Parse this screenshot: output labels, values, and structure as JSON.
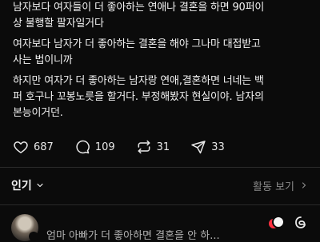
{
  "post": {
    "lines": [
      "남자보다 여자들이 더 좋아하는 연애나 결혼을 하면 90퍼이",
      "상 불행할 팔자일거다",
      "여자보다 남자가 더 좋아하는 결혼을 해야 그나마 대접받고",
      "사는 법이니까",
      "하지만 여자가 더 좋아하는 남자랑 연애,결혼하면 너네는 백",
      "퍼 호구나 꼬봉노릇을 할거다. 부정해봤자 현실이야. 남자의",
      "본능이거던."
    ]
  },
  "actions": {
    "likes": "687",
    "comments": "109",
    "reposts": "31",
    "shares": "33",
    "icons": [
      "heart-icon",
      "comment-icon",
      "repost-icon",
      "share-icon"
    ]
  },
  "sort": {
    "label": "인기",
    "activity_label": "활동 보기"
  },
  "comment_preview": {
    "partial_text": "엄마 아빠가 더 좋아하면 결혼을 안 하..."
  },
  "colors": {
    "background": "#0b0b0b",
    "text": "#f2f2f2",
    "muted": "#8a8a8a",
    "like_red": "#ff3040"
  }
}
